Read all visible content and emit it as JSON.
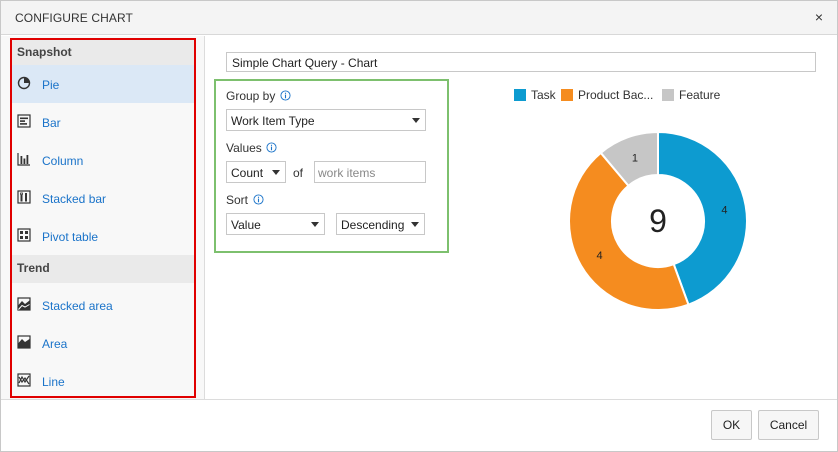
{
  "dialog": {
    "title": "CONFIGURE CHART",
    "close_glyph": "×"
  },
  "sidebar": {
    "snapshot_header": "Snapshot",
    "trend_header": "Trend",
    "snapshot_items": [
      {
        "label": "Pie",
        "icon": "pie-icon",
        "selected": true
      },
      {
        "label": "Bar",
        "icon": "bar-chart-icon"
      },
      {
        "label": "Column",
        "icon": "column-chart-icon"
      },
      {
        "label": "Stacked bar",
        "icon": "stacked-bar-icon"
      },
      {
        "label": "Pivot table",
        "icon": "pivot-table-icon"
      }
    ],
    "trend_items": [
      {
        "label": "Stacked area",
        "icon": "stacked-area-icon"
      },
      {
        "label": "Area",
        "icon": "area-chart-icon"
      },
      {
        "label": "Line",
        "icon": "line-chart-icon"
      }
    ]
  },
  "config": {
    "chart_name": "Simple Chart Query - Chart",
    "group_by_label": "Group by",
    "group_by_value": "Work Item Type",
    "values_label": "Values",
    "values_value": "Count",
    "of_label": "of",
    "values_placeholder": "work items",
    "sort_label": "Sort",
    "sort_by_value": "Value",
    "sort_order_value": "Descending"
  },
  "chart_data": {
    "type": "pie",
    "categories": [
      "Task",
      "Product Bac...",
      "Feature"
    ],
    "values": [
      4,
      4,
      1
    ],
    "total_label": "9",
    "colors": [
      "#0d9bd0",
      "#f58c1f",
      "#c6c6c6"
    ],
    "legend": "top"
  },
  "footer": {
    "ok_label": "OK",
    "cancel_label": "Cancel"
  },
  "colors": {
    "highlight_red": "#e00000",
    "highlight_green": "#7dc06e",
    "link_blue": "#1a73c9"
  }
}
